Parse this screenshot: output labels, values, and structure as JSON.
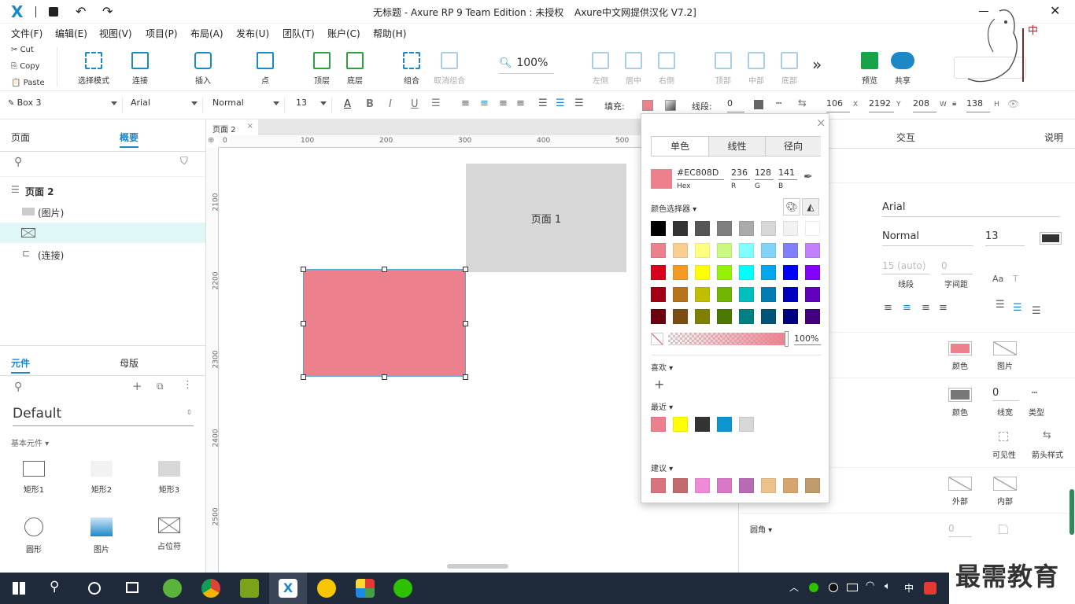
{
  "titlebar": {
    "logo": "X",
    "title": "无标题 - Axure RP 9 Team Edition : 未授权",
    "subtitle": "Axure中文网提供汉化 V7.2]"
  },
  "menu": [
    "文件(F)",
    "编辑(E)",
    "视图(V)",
    "项目(P)",
    "布局(A)",
    "发布(U)",
    "团队(T)",
    "账户(C)",
    "帮助(H)"
  ],
  "clipboard": {
    "cut": "Cut",
    "copy": "Copy",
    "paste": "Paste"
  },
  "toolbar": {
    "select_mode": "选择模式",
    "connect": "连接",
    "insert": "插入",
    "point": "点",
    "top": "顶层",
    "bottom": "底层",
    "group": "组合",
    "ungroup": "取消组合",
    "zoom": "100%",
    "align_left": "左侧",
    "align_center": "居中",
    "align_right": "右侧",
    "align_top": "顶部",
    "align_middle": "中部",
    "align_bottom": "底部",
    "more": "»",
    "preview": "预览",
    "share": "共享"
  },
  "stylebar": {
    "style": "Box 3",
    "font": "Arial",
    "weight": "Normal",
    "size": "13",
    "fill_label": "填充:",
    "stroke_label": "线段:",
    "stroke_width": "0",
    "x": "106",
    "x_label": "X",
    "y": "2192",
    "y_label": "Y",
    "w": "208",
    "w_label": "W",
    "h": "138",
    "h_label": "H"
  },
  "left": {
    "tab_pages": "页面",
    "tab_outline": "概要",
    "outline": [
      {
        "label": "页面 2"
      },
      {
        "label": "(图片)"
      },
      {
        "label": ""
      },
      {
        "label": "(连接)"
      }
    ],
    "tab_widgets": "元件",
    "tab_masters": "母版",
    "library": "Default",
    "category": "基本元件 ▾",
    "widgets": [
      "矩形1",
      "矩形2",
      "矩形3",
      "圆形",
      "图片",
      "占位符"
    ]
  },
  "canvas": {
    "tab": "页面 2",
    "ruler_x": [
      "0",
      "100",
      "200",
      "300",
      "400",
      "500"
    ],
    "ruler_y": [
      "2100",
      "2200",
      "2300",
      "2400",
      "2500"
    ],
    "box_label": "页面 1"
  },
  "picker": {
    "tabs": [
      "单色",
      "线性",
      "径向"
    ],
    "hex": "#EC808D",
    "hex_label": "Hex",
    "r": "236",
    "g": "128",
    "b": "141",
    "r_label": "R",
    "g_label": "G",
    "b_label": "B",
    "selector_label": "颜色选择器 ▾",
    "palette": [
      [
        "#000000",
        "#333333",
        "#555555",
        "#7f7f7f",
        "#aaaaaa",
        "#d7d7d7",
        "#f2f2f2",
        "#ffffff"
      ],
      [
        "#ec808d",
        "#facd91",
        "#ffff80",
        "#caf982",
        "#80ffff",
        "#81d3f8",
        "#8080ff",
        "#c280ff"
      ],
      [
        "#d9001b",
        "#f59a23",
        "#ffff00",
        "#95f204",
        "#00ffff",
        "#02a7f0",
        "#0000ff",
        "#8400ff"
      ],
      [
        "#a30014",
        "#b8741a",
        "#bfbf00",
        "#70b603",
        "#00bfbf",
        "#027db4",
        "#0000bf",
        "#6300bf"
      ],
      [
        "#6d000e",
        "#7b4d12",
        "#808000",
        "#4b7902",
        "#008080",
        "#015478",
        "#000080",
        "#420080"
      ]
    ],
    "opacity": "100%",
    "favorites_label": "喜欢 ▾",
    "recent_label": "最近 ▾",
    "recent": [
      "#ec808d",
      "#ffff00",
      "#333333",
      "#0b96d0",
      "#d7d7d7"
    ],
    "suggest_label": "建议 ▾",
    "suggest": [
      "#d9737e",
      "#c26a6e",
      "#f08ad8",
      "#d977c8",
      "#b86bb5",
      "#ecc28a",
      "#d6a56f",
      "#c09a6c"
    ]
  },
  "right": {
    "tab_interact": "交互",
    "tab_notes": "说明",
    "font": "Arial",
    "weight": "Normal",
    "size": "13",
    "line_height": "15 (auto)",
    "line_height_label": "线段",
    "spacing": "0",
    "spacing_label": "字间距",
    "fill_color_label": "颜色",
    "fill_image_label": "图片",
    "border_color_label": "颜色",
    "border_width": "0",
    "border_width_label": "线宽",
    "border_type_label": "类型",
    "visible_label": "可见性",
    "arrow_label": "箭头样式",
    "shadow_outer": "外部",
    "shadow_inner": "内部",
    "radius_label": "圆角 ▾",
    "radius_value": "0"
  },
  "taskbar": {
    "ime": "中"
  },
  "watermark": "最需教育",
  "colors": {
    "accent": "#1e88c7",
    "fill": "#ec808d",
    "gray_box": "#d7d7d7"
  }
}
